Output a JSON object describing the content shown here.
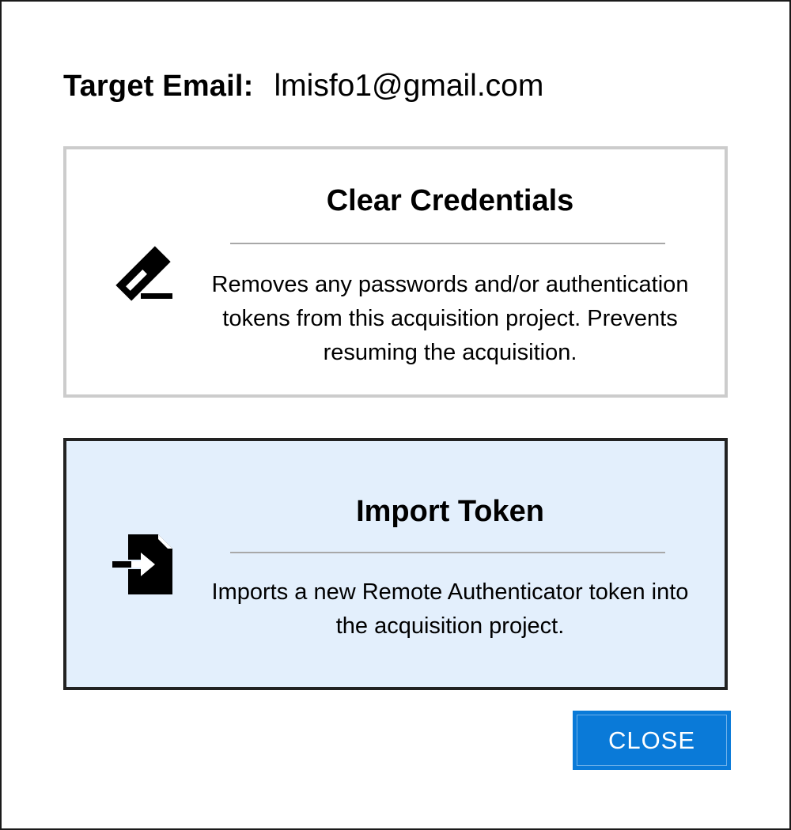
{
  "target": {
    "label": "Target Email:",
    "email": "lmisfo1@gmail.com"
  },
  "options": [
    {
      "title": "Clear Credentials",
      "description": "Removes any passwords and/or authentication tokens from this acquisition project. Prevents resuming the acquisition.",
      "icon": "eraser-icon",
      "selected": false
    },
    {
      "title": "Import Token",
      "description": "Imports a new Remote Authenticator token into the acquisition project.",
      "icon": "file-import-icon",
      "selected": true
    }
  ],
  "buttons": {
    "close_label": "CLOSE"
  },
  "colors": {
    "selected_background": "#e3effc",
    "selected_border": "#222222",
    "unselected_border": "#cccccc",
    "primary_button": "#0a7ad8"
  }
}
